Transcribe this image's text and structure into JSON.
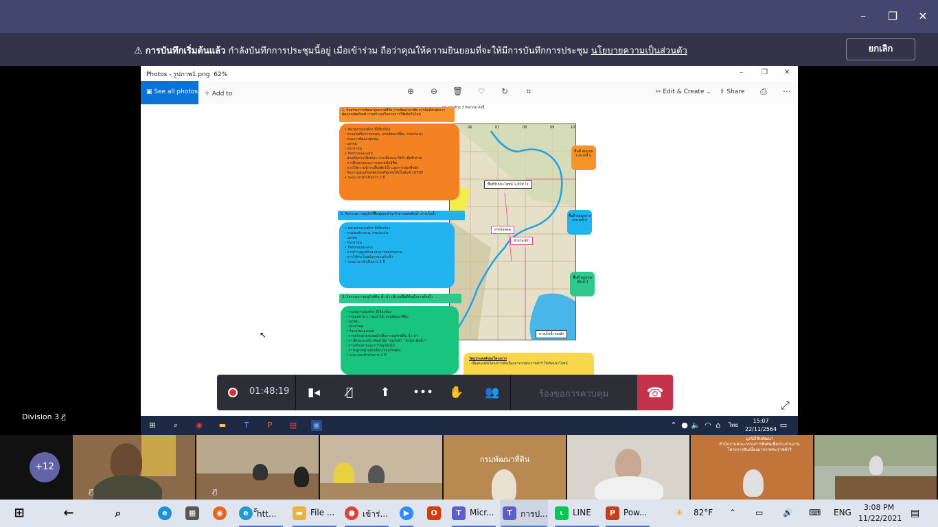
{
  "window": {
    "controls": [
      "–",
      "❐",
      "✕"
    ]
  },
  "recording_banner": {
    "bold": "การบันทึกเริ่มต้นแล้ว",
    "message": "กำลังบันทึกการประชุมนี้อยู่ เมื่อเข้าร่วม ถือว่าคุณให้ความยินยอมที่จะให้มีการบันทึกการประชุม",
    "link": "นโยบายความเป็นส่วนตัว",
    "cancel": "ยกเลิก"
  },
  "photos_app": {
    "title": "Photos - รูปภาพ1.png",
    "zoom": "62%",
    "see_all": "See all photos",
    "add_to": "Add to",
    "edit_create": "Edit & Create",
    "share": "Share"
  },
  "document": {
    "top_note": "ประกอบด้วย 3 กิจกรรม ดังนี้",
    "section1_header": "1. กิจกรรมการพัฒนาคุณภาพชีวิต การพัฒนาอาชีพ การจัดตั้งกลุ่มการพัฒนาผลิตภัณฑ์ การสร้างเครือข่ายการใช้ผลิตในไลน์",
    "section1_body": [
      "• หน่วยงาน/องค์กร ที่เกี่ยวข้อง",
      "- กรมส่งเสริมการเกษตร, กรมพัฒนาที่ดิน, กรมประมง",
      "- กรมการพัฒนาชุมชน,",
      "- เอกชน",
      "- ประชาชน",
      "• กิจกรรมและแผน",
      "- ส่งเสริมการเลี้ยงปลา การเลี้ยงและใช้น้ำเพื่อชีวภาพ",
      "- การฝึกอบรมและการขยายพันธุ์พืช",
      "- การให้ความรู้การเลี้ยงสัตว์น้ำ และการปลูกพืชผัก",
      "- กิจกรรมส่งเสริมผลิตภัณฑ์ชุมชนให้เป็นสินค้า OTOP",
      "• ระยะเวลาดำเนินการ  2 ปี"
    ],
    "section2_header": "2. กิจกรรมการอนุรักษ์ฟื้นฟูและบำรุงรักษาแหล่งต้นน้ำ อ่างเก็บน้ำ",
    "section2_body": [
      "• หน่วยงาน/องค์กร ที่เกี่ยวข้อง",
      "- กรมชลประทาน, กรมประมง",
      "- เอกชน",
      "- ประชาชน",
      "• กิจกรรมและแผน",
      "- การบำรุงดูแลรักษาอาคารชลประทาน",
      "- การใช้ประโยชน์จากอ่างเก็บน้ำ",
      "• ระยะเวลาดำเนินการ  2 ปี"
    ],
    "section3_header": "3. กิจกรรมการอนุรักษ์ดิน น้ำ ป่า บริเวณพื้นที่ต้นน้ำอ่างเก็บน้ำ",
    "section3_body": [
      "• หน่วยงาน/องค์กร ที่เกี่ยวข้อง",
      "- กรมอุทยานฯ, กรมป่าไม้, กรมพัฒนาที่ดิน",
      "- เอกชน",
      "- ประชาชน",
      "• กิจกรรมและแผน",
      "- การสร้างฝายชะลอน้ำเพื่อการอนุรักษ์ดิน น้ำ ป่า",
      "- การฝึกอบรมสร้างจิตสำนึก \"อนุรักษ์\", \"รักษ์ป่าต้นน้ำ\"",
      "- การสร้างฝายและการปลูกต้นไม้",
      "- การปลูกหญ้าแฝกเพื่อการอนุรักษ์ดิน",
      "• ระยะเวลาดำเนินการ  2 ปี"
    ],
    "zone_top": "พื้นที่ ตอนบน (ปลายน้ำ)",
    "zone_mid": "พื้นที่ ตอนกลาง (กลางน้ำ)",
    "zone_low": "พื้นที่ ตอนบน (ต้นน้ำ)",
    "map_label1": "พื้นที่รับประโยชน์ 1,000 ไร่",
    "map_label2": "ฝายร้อยคุด",
    "map_label3": "ฝายร่องผัก",
    "map_label4": "อ่างเก็บน้ำร่องผัก",
    "grid": [
      "06",
      "07",
      "08",
      "09",
      "10"
    ],
    "objective_title": "วัตถุประสงค์ของโครงการ",
    "objective_body": "- เพื่อสนองต่อโครงการอันเนื่องมาจากพระราชดำริ ให้เกิดประโยชน์"
  },
  "meeting_controls": {
    "timer": "01:48:19",
    "request_control": "ร้องขอการควบคุม"
  },
  "remote_desktop": {
    "lang": "ไทย",
    "time": "15:07",
    "date": "22/11/2564"
  },
  "speaker": {
    "name": "Division 3"
  },
  "gallery": {
    "more": "+12",
    "tile4_sign": "กรมพัฒนาที่ดิน",
    "tile6_sign1": "มูลนิธิชัยพัฒนา",
    "tile6_sign2": "สำนักงานคณะกรรมการพิเศษเพื่อประสานงาน",
    "tile6_sign3": "โครงการอันเนื่องมาจากพระราชดำริ"
  },
  "taskbar": {
    "apps": [
      {
        "label": "ั้htt...",
        "color": "#1e9bd7",
        "icon": "e"
      },
      {
        "label": "File ...",
        "color": "#e8b43a",
        "icon": "▬"
      },
      {
        "label": "เข้าร่...",
        "color": "#db4437",
        "icon": "●"
      },
      {
        "label": "",
        "color": "#2d8cff",
        "icon": "▶"
      },
      {
        "label": "",
        "color": "#d83b01",
        "icon": "O"
      },
      {
        "label": "Micr...",
        "color": "#5b5fc7",
        "icon": "T"
      },
      {
        "label": "การป...",
        "color": "#5b5fc7",
        "icon": "T"
      },
      {
        "label": "LINE",
        "color": "#06c755",
        "icon": "L"
      },
      {
        "label": "Pow...",
        "color": "#c43e1c",
        "icon": "P"
      }
    ],
    "weather": "82°F",
    "lang": "ENG",
    "time": "3:08 PM",
    "date": "11/22/2021"
  }
}
